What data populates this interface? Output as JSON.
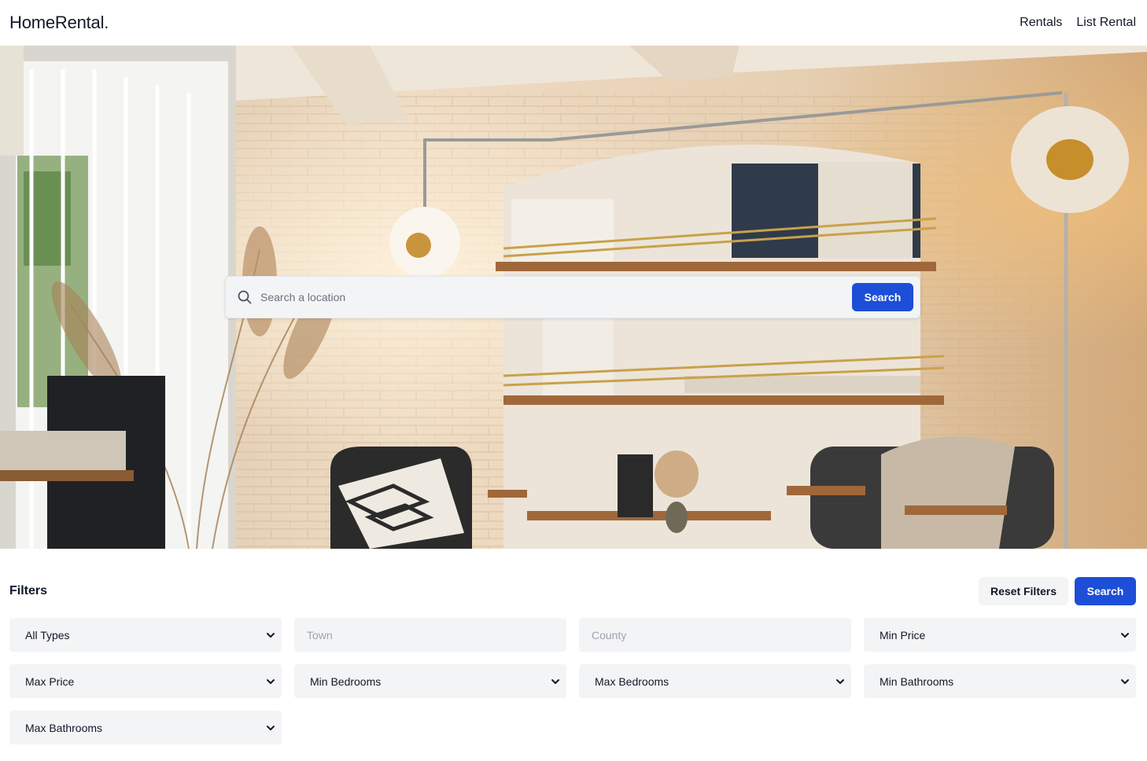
{
  "nav": {
    "brand": "HomeRental.",
    "links": [
      "Rentals",
      "List Rental"
    ]
  },
  "hero": {
    "image_alt": "interior-living-room-photo",
    "search": {
      "placeholder": "Search a location",
      "button_label": "Search"
    }
  },
  "filters": {
    "title": "Filters",
    "reset_label": "Reset Filters",
    "search_label": "Search",
    "fields": [
      {
        "kind": "select",
        "value": "All Types"
      },
      {
        "kind": "input",
        "placeholder": "Town"
      },
      {
        "kind": "input",
        "placeholder": "County"
      },
      {
        "kind": "select",
        "value": "Min Price"
      },
      {
        "kind": "select",
        "value": "Max Price"
      },
      {
        "kind": "select",
        "value": "Min Bedrooms"
      },
      {
        "kind": "select",
        "value": "Max Bedrooms"
      },
      {
        "kind": "select",
        "value": "Min Bathrooms"
      },
      {
        "kind": "select",
        "value": "Max Bathrooms"
      }
    ]
  },
  "colors": {
    "primary": "#1d4ed8",
    "field_bg": "#f3f4f6",
    "text": "#111827"
  }
}
